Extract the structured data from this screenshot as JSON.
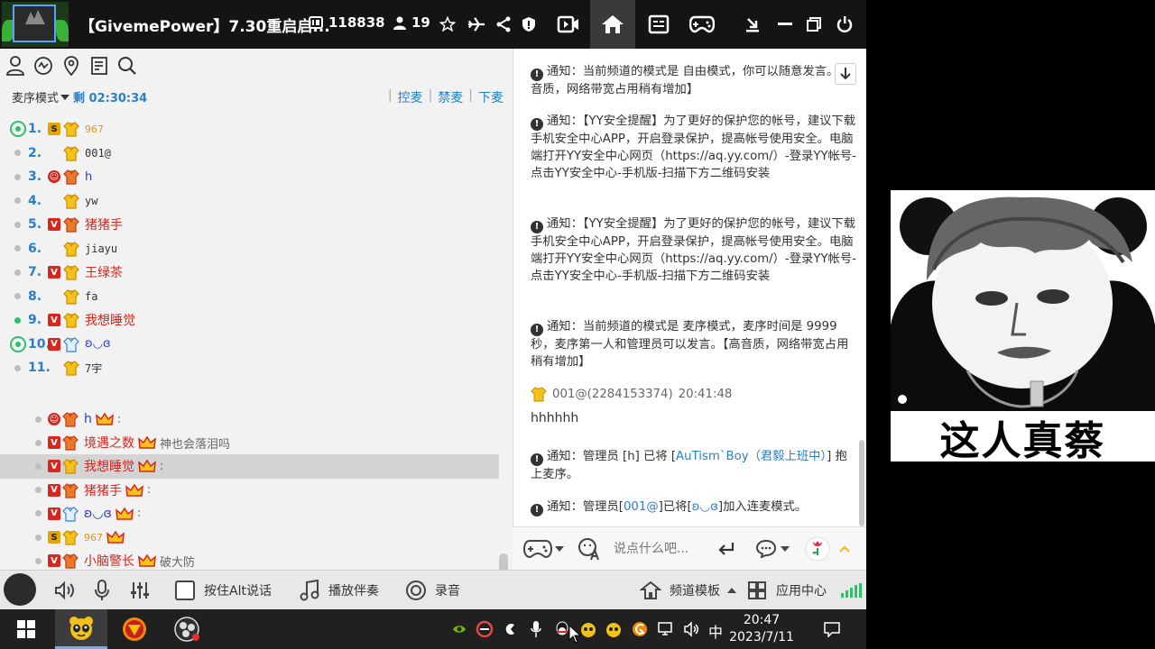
{
  "titlebar": {
    "channel_title": "【GivemePower】7.30重启启...",
    "channel_id": "118838",
    "online_count": "19"
  },
  "leftpanel": {
    "mic_mode": "麦序模式",
    "mic_time": "剩 02:30:34",
    "actions": [
      "控麦",
      "禁麦",
      "下麦"
    ],
    "queue": [
      {
        "num": "1.",
        "name": "967",
        "badge": "s",
        "marker": "ring",
        "style": "nm-gold",
        "shirt": "gold"
      },
      {
        "num": "2.",
        "name": "001@",
        "badge": "",
        "marker": "dot",
        "style": "nm-dark",
        "shirt": "gold"
      },
      {
        "num": "3.",
        "name": "h",
        "badge": "e",
        "marker": "dot",
        "style": "nm-blue",
        "shirt": "red"
      },
      {
        "num": "4.",
        "name": "yw",
        "badge": "",
        "marker": "dot",
        "style": "nm-dark",
        "shirt": "gold"
      },
      {
        "num": "5.",
        "name": "猪猪手",
        "badge": "v",
        "marker": "dot",
        "style": "nm-red",
        "shirt": "red"
      },
      {
        "num": "6.",
        "name": "jiayu",
        "badge": "",
        "marker": "dot",
        "style": "nm-dark",
        "shirt": "gold"
      },
      {
        "num": "7.",
        "name": "王绿茶",
        "badge": "v",
        "marker": "dot",
        "style": "nm-red",
        "shirt": "gold"
      },
      {
        "num": "8.",
        "name": "fa",
        "badge": "",
        "marker": "dot",
        "style": "nm-dark",
        "shirt": "gold"
      },
      {
        "num": "9.",
        "name": "我想睡觉",
        "badge": "v",
        "marker": "green",
        "style": "nm-red",
        "shirt": "gold"
      },
      {
        "num": "10.",
        "name": "ʚ◡ɞ",
        "badge": "v",
        "marker": "ring",
        "style": "nm-blue",
        "shirt": "blue"
      },
      {
        "num": "11.",
        "name": "7宇",
        "badge": "",
        "marker": "dot",
        "style": "nm-dark",
        "shirt": "gold"
      }
    ],
    "users": [
      {
        "name": "h",
        "badge": "e",
        "shirt": "red",
        "style": "nm-blue",
        "crown": true,
        "status": ":"
      },
      {
        "name": "境遇之数",
        "badge": "v",
        "shirt": "red",
        "style": "nm-red",
        "crown": true,
        "status": "神也会落泪吗"
      },
      {
        "name": "我想睡觉",
        "badge": "v",
        "shirt": "gold",
        "style": "nm-red",
        "crown": true,
        "status": ":",
        "selected": true
      },
      {
        "name": "猪猪手",
        "badge": "v",
        "shirt": "red",
        "style": "nm-red",
        "crown": true,
        "status": ":"
      },
      {
        "name": "ʚ◡ɞ",
        "badge": "v",
        "shirt": "blue",
        "style": "nm-blue",
        "crown": true,
        "status": ":"
      },
      {
        "name": "967",
        "badge": "s",
        "shirt": "gold",
        "style": "nm-gold",
        "crown": true,
        "status": ""
      },
      {
        "name": "小脑警长",
        "badge": "v",
        "shirt": "red",
        "style": "nm-red",
        "crown": true,
        "status": "破大防"
      }
    ]
  },
  "chat": {
    "messages": [
      "通知：当前频道的模式是 自由模式，你可以随意发言。【高音质，网络带宽占用稍有增加】",
      "通知：【YY安全提醒】为了更好的保护您的帐号，建议下载手机安全中心APP，开启登录保护，提高帐号使用安全。电脑端打开YY安全中心网页（https://aq.yy.com/）-登录YY帐号-点击YY安全中心-手机版-扫描下方二维码安装",
      "通知：【YY安全提醒】为了更好的保护您的帐号，建议下载手机安全中心APP，开启登录保护，提高帐号使用安全。电脑端打开YY安全中心网页（https://aq.yy.com/）-登录YY帐号-点击YY安全中心-手机版-扫描下方二维码安装",
      "通知：当前频道的模式是 麦序模式，麦序时间是 9999 秒，麦序第一人和管理员可以发言。【高音质，网络带宽占用稍有增加】"
    ],
    "user_line": "001@(2284153374)",
    "user_time": "20:41:48",
    "user_text": "hhhhhh",
    "notice5_prefix": "通知：管理员 [h] 已将 [",
    "notice5_link": "AuTism`Boy（君毅上班中）",
    "notice5_suffix": "] 抱上麦序。",
    "notice6_prefix": "通知：管理员[",
    "notice6_link1": "001@",
    "notice6_mid": "]已将[",
    "notice6_link2": "ʚ◡ɞ",
    "notice6_suffix": "]加入连麦模式。",
    "input_placeholder": "说点什么吧..."
  },
  "bottombar": {
    "alt_talk": "按住Alt说话",
    "accompany": "播放伴奏",
    "record": "录音",
    "template": "频道模板",
    "app_center": "应用中心"
  },
  "meme": {
    "caption": "这人真蔡"
  },
  "taskbar": {
    "time": "20:47",
    "date": "2023/7/11",
    "ime": "中"
  },
  "colors": {
    "accent": "#2a7fc8",
    "red": "#d7261e",
    "gold": "#d99a1c"
  }
}
